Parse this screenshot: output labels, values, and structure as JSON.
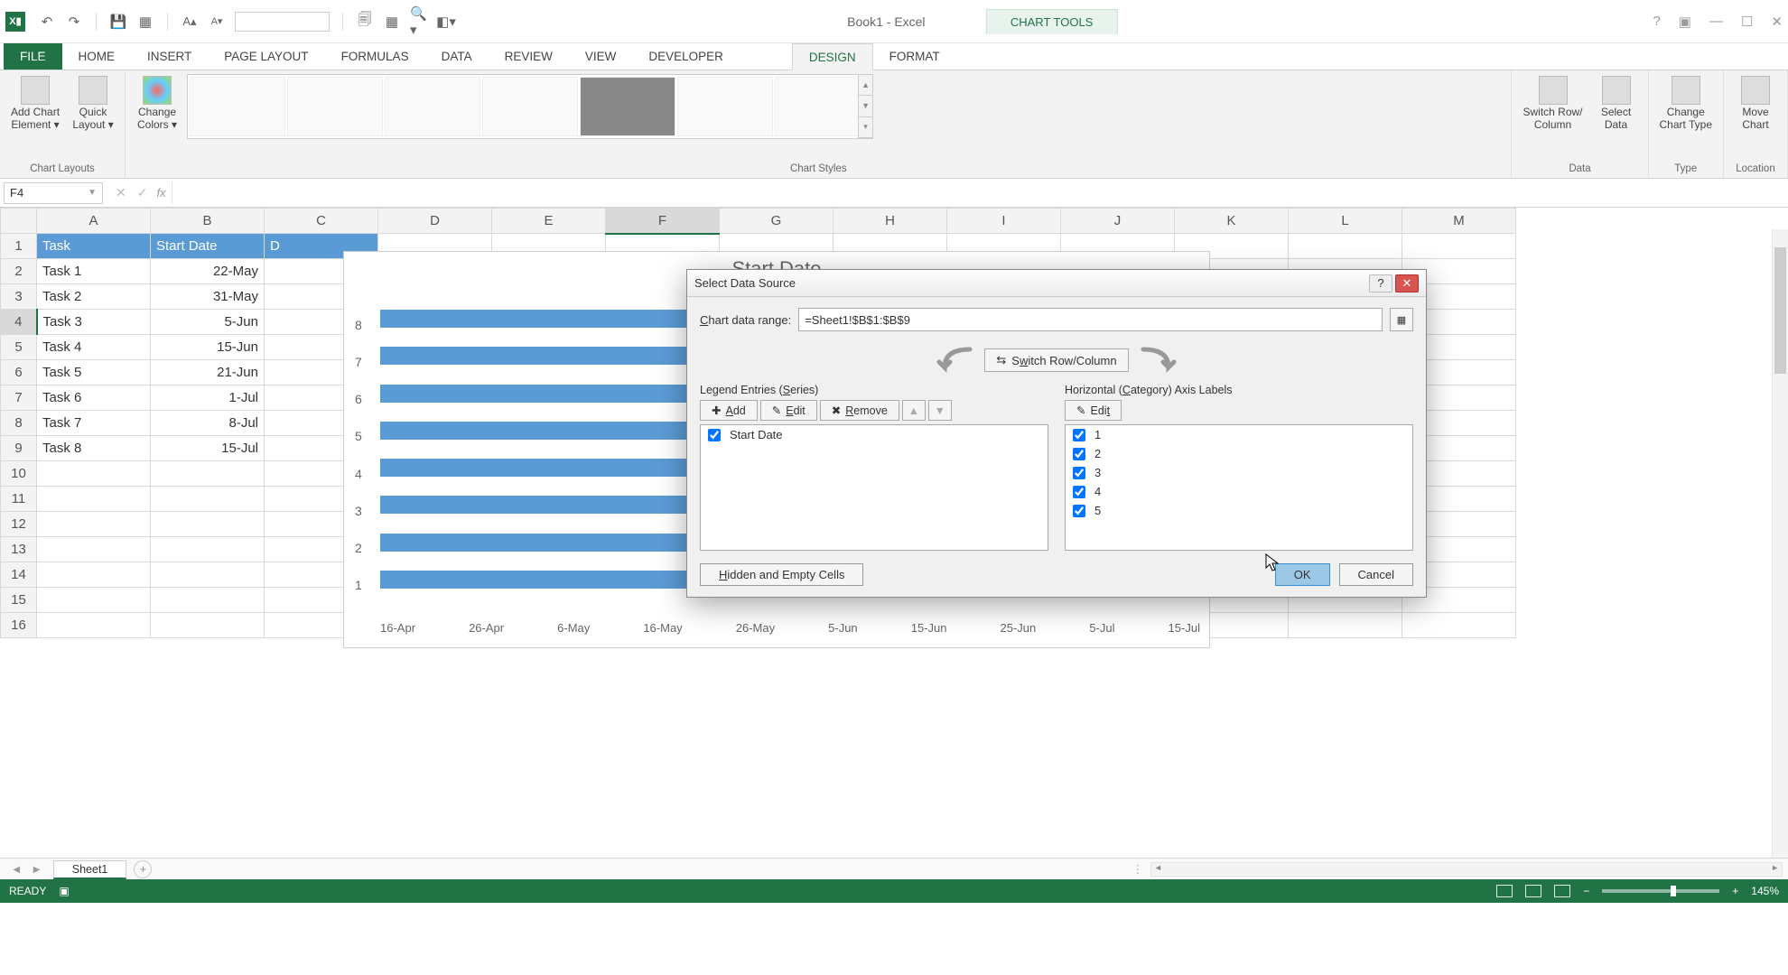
{
  "app": {
    "doc_title": "Book1 - Excel",
    "tool_context": "CHART TOOLS"
  },
  "tabs": {
    "file": "FILE",
    "list": [
      "HOME",
      "INSERT",
      "PAGE LAYOUT",
      "FORMULAS",
      "DATA",
      "REVIEW",
      "VIEW",
      "DEVELOPER"
    ],
    "tool": [
      "DESIGN",
      "FORMAT"
    ],
    "active_tool": "DESIGN"
  },
  "ribbon": {
    "groups": {
      "chart_layouts": {
        "label": "Chart Layouts",
        "add_element": "Add Chart\nElement ▾",
        "quick_layout": "Quick\nLayout ▾"
      },
      "chart_styles": {
        "label": "Chart Styles",
        "change_colors": "Change\nColors ▾"
      },
      "data": {
        "label": "Data",
        "switch": "Switch Row/\nColumn",
        "select": "Select\nData"
      },
      "type": {
        "label": "Type",
        "change_type": "Change\nChart Type"
      },
      "location": {
        "label": "Location",
        "move": "Move\nChart"
      }
    }
  },
  "formula_bar": {
    "name_box": "F4",
    "formula": ""
  },
  "columns": [
    "A",
    "B",
    "C",
    "D",
    "E",
    "F",
    "G",
    "H",
    "I",
    "J",
    "K",
    "L",
    "M"
  ],
  "sheet": {
    "headers": {
      "task": "Task",
      "start": "Start Date",
      "colC": "D"
    },
    "rows": [
      {
        "task": "Task 1",
        "start": "22-May"
      },
      {
        "task": "Task 2",
        "start": "31-May"
      },
      {
        "task": "Task 3",
        "start": "5-Jun"
      },
      {
        "task": "Task 4",
        "start": "15-Jun"
      },
      {
        "task": "Task 5",
        "start": "21-Jun"
      },
      {
        "task": "Task 6",
        "start": "1-Jul"
      },
      {
        "task": "Task 7",
        "start": "8-Jul"
      },
      {
        "task": "Task 8",
        "start": "15-Jul"
      }
    ],
    "selected_row": 4,
    "selected_col": "F"
  },
  "chart_data": {
    "type": "bar",
    "title": "Start Date",
    "categories": [
      "1",
      "2",
      "3",
      "4",
      "5",
      "6",
      "7",
      "8"
    ],
    "x_ticks": [
      "16-Apr",
      "26-Apr",
      "6-May",
      "16-May",
      "26-May",
      "5-Jun",
      "15-Jun",
      "25-Jun",
      "5-Jul",
      "15-Jul"
    ],
    "series": [
      {
        "name": "Start Date",
        "values_label": [
          "22-May",
          "31-May",
          "5-Jun",
          "15-Jun",
          "21-Jun",
          "1-Jul",
          "8-Jul",
          "15-Jul"
        ],
        "bar_fraction": [
          0.4,
          0.5,
          0.56,
          0.67,
          0.73,
          0.84,
          0.92,
          0.99
        ]
      }
    ]
  },
  "dialog": {
    "title": "Select Data Source",
    "range_label": "Chart data range:",
    "range_value": "=Sheet1!$B$1:$B$9",
    "switch_btn": "Switch Row/Column",
    "legend_caption": "Legend Entries (Series)",
    "axis_caption": "Horizontal (Category) Axis Labels",
    "btn_add": "Add",
    "btn_edit": "Edit",
    "btn_remove": "Remove",
    "series": [
      "Start Date"
    ],
    "axis_labels": [
      "1",
      "2",
      "3",
      "4",
      "5"
    ],
    "hidden_btn": "Hidden and Empty Cells",
    "ok": "OK",
    "cancel": "Cancel"
  },
  "sheet_tabs": {
    "active": "Sheet1"
  },
  "status": {
    "ready": "READY",
    "zoom": "145%"
  }
}
